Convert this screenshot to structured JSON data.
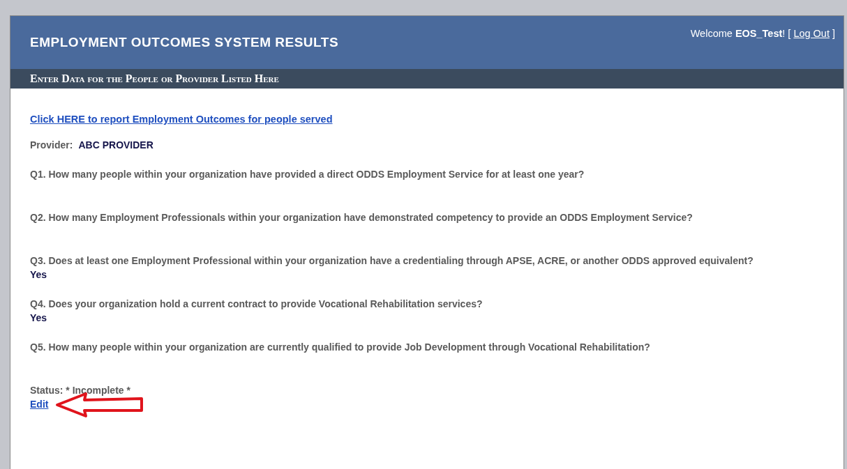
{
  "header": {
    "title": "EMPLOYMENT OUTCOMES SYSTEM RESULTS",
    "welcome": "Welcome **EOS_Test**!",
    "bracket_open": "[",
    "logout": "Log Out",
    "bracket_close": "]"
  },
  "subheader": "Enter Data for the People or Provider Listed Here",
  "report_link": "Click HERE to report Employment Outcomes for people served",
  "provider": {
    "label": "Provider:",
    "value": "ABC PROVIDER"
  },
  "questions": [
    {
      "text": "Q1. How many people within your organization have provided a direct ODDS Employment Service for at least one year?"
    },
    {
      "text": "Q2. How many Employment Professionals within your organization have demonstrated competency to provide an ODDS Employment Service?"
    },
    {
      "text": "Q3. Does at least one Employment Professional within your organization have a credentialing through APSE, ACRE, or another ODDS approved equivalent?",
      "answer": "Yes"
    },
    {
      "text": "Q4. Does your organization hold a current contract to provide Vocational Rehabilitation services?",
      "answer": "Yes"
    },
    {
      "text": "Q5. How many people within your organization are currently qualified to provide Job Development through Vocational Rehabilitation?"
    }
  ],
  "status": "Status: * Incomplete *",
  "edit_link": "Edit"
}
